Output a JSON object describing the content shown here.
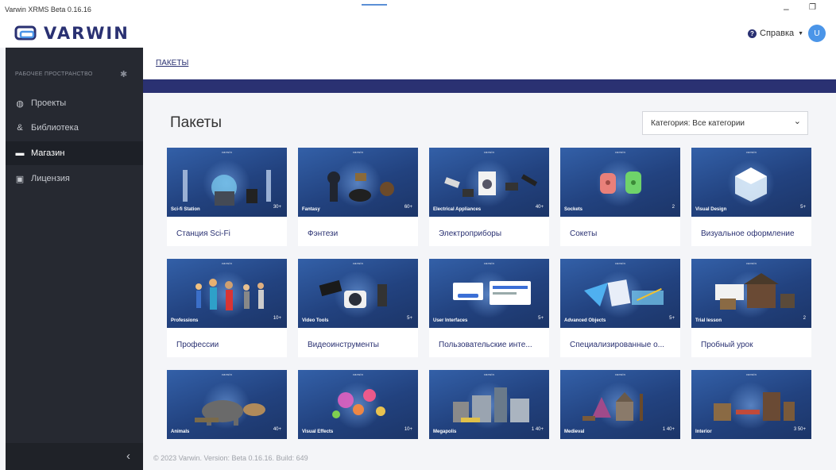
{
  "window": {
    "title": "Varwin XRMS Beta 0.16.16",
    "minimize_glyph": "–",
    "restore_glyph": "❐"
  },
  "header": {
    "brand": "VARWIN",
    "logo_icon": "varwin-logo-icon",
    "help_label": "Справка",
    "help_icon": "question-circle-icon",
    "avatar_letter": "U",
    "colors": {
      "brand": "#2a3172",
      "avatar": "#4b95e8"
    }
  },
  "sidebar": {
    "workspace_label": "РАБОЧЕЕ ПРОСТРАНСТВО",
    "workspace_icon": "gear-icon",
    "items": [
      {
        "label": "Проекты",
        "icon": "globe-icon",
        "active": false
      },
      {
        "label": "Библиотека",
        "icon": "shapes-icon",
        "active": false
      },
      {
        "label": "Магазин",
        "icon": "store-icon",
        "active": true
      },
      {
        "label": "Лицензия",
        "icon": "license-icon",
        "active": false
      }
    ],
    "collapse_icon": "chevron-left-icon",
    "colors": {
      "background": "#262931",
      "active": "#1d2027"
    }
  },
  "breadcrumb": "ПАКЕТЫ",
  "page": {
    "title": "Пакеты",
    "category_select": {
      "value": "Категория: Все категории",
      "icon": "chevron-down-icon"
    }
  },
  "cards": [
    {
      "title": "Станция Sci-Fi",
      "tag": "Sci-fi Station",
      "count": "30+"
    },
    {
      "title": "Фэнтези",
      "tag": "Fantasy",
      "count": "60+"
    },
    {
      "title": "Электроприборы",
      "tag": "Electrical Appliances",
      "count": "40+"
    },
    {
      "title": "Сокеты",
      "tag": "Sockets",
      "count": "2"
    },
    {
      "title": "Визуальное оформление",
      "tag": "Visual Design",
      "count": "5+"
    },
    {
      "title": "Профессии",
      "tag": "Professions",
      "count": "10+"
    },
    {
      "title": "Видеоинструменты",
      "tag": "Video Tools",
      "count": "5+"
    },
    {
      "title": "Пользовательские инте...",
      "tag": "User Interfaces",
      "count": "5+"
    },
    {
      "title": "Специализированные о...",
      "tag": "Advanced Objects",
      "count": "5+"
    },
    {
      "title": "Пробный урок",
      "tag": "Trial lesson",
      "count": "2"
    },
    {
      "title": "",
      "tag": "Animals",
      "count": "40+"
    },
    {
      "title": "",
      "tag": "Visual Effects",
      "count": "10+"
    },
    {
      "title": "",
      "tag": "Megapolis",
      "count": "1  40+"
    },
    {
      "title": "",
      "tag": "Medieval",
      "count": "1  40+"
    },
    {
      "title": "",
      "tag": "Interior",
      "count": "3  50+"
    }
  ],
  "thumb_brand": "varwin",
  "footer": "© 2023 Varwin. Version: Beta 0.16.16. Build: 649",
  "colors": {
    "thumb_top": "#3360a8",
    "thumb_bottom": "#1c3568",
    "accent_bar": "#2a3172"
  }
}
